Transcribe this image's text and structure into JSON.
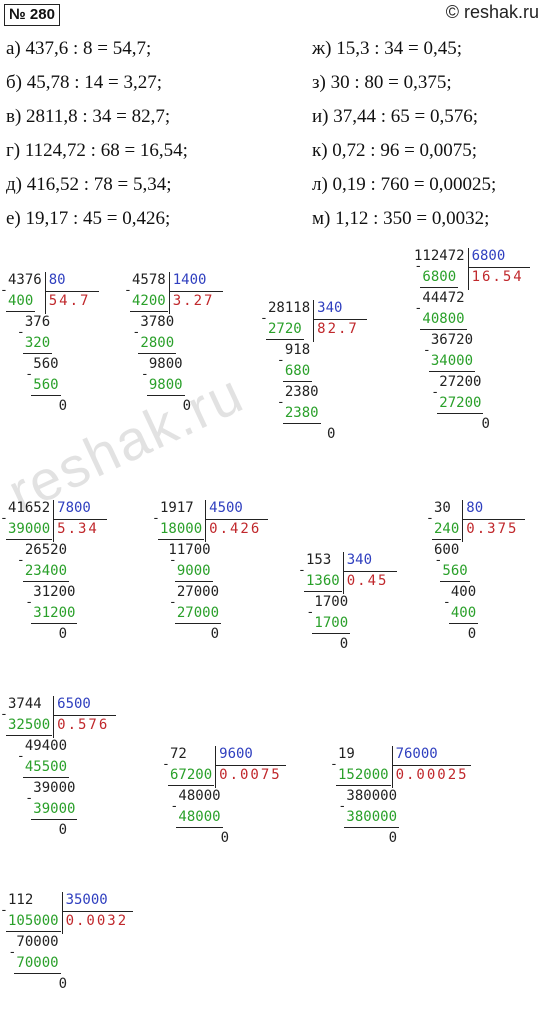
{
  "header": {
    "badge": "№ 280",
    "site": "© reshak.ru"
  },
  "equations": {
    "a": "а) 437,6 : 8 = 54,7;",
    "b": "б) 45,78 : 14 = 3,27;",
    "v": "в) 2811,8 : 34 = 82,7;",
    "g": "г) 1124,72 : 68 = 16,54;",
    "d": "д) 416,52 : 78 = 5,34;",
    "e": "е) 19,17 : 45 = 0,426;",
    "zh": "ж) 15,3 : 34 = 0,45;",
    "z": "з) 30 : 80 = 0,375;",
    "i": "и) 37,44 : 65 = 0,576;",
    "k": "к) 0,72 : 96 = 0,0075;",
    "l": "л) 0,19 : 760 = 0,00025;",
    "m": "м) 1,12 : 350 = 0,0032;"
  },
  "divisions": {
    "d1": {
      "dividend": "4376",
      "divisor": "80",
      "quotient": "54.7",
      "rows": [
        "400",
        "376",
        "320",
        "560",
        "560",
        "0"
      ]
    },
    "d2": {
      "dividend": "4578",
      "divisor": "1400",
      "quotient": "3.27",
      "rows": [
        "4200",
        "3780",
        "2800",
        "9800",
        "9800",
        "0"
      ]
    },
    "d3": {
      "dividend": "28118",
      "divisor": "340",
      "quotient": "82.7",
      "rows": [
        "2720",
        "918",
        "680",
        "2380",
        "2380",
        "0"
      ]
    },
    "d4": {
      "dividend": "112472",
      "divisor": "6800",
      "quotient": "16.54",
      "rows": [
        "6800",
        "44472",
        "40800",
        "36720",
        "34000",
        "27200",
        "27200",
        "0"
      ]
    },
    "d5": {
      "dividend": "41652",
      "divisor": "7800",
      "quotient": "5.34",
      "rows": [
        "39000",
        "26520",
        "23400",
        "31200",
        "31200",
        "0"
      ]
    },
    "d6": {
      "dividend": "1917",
      "divisor": "4500",
      "quotient": "0.426",
      "rows": [
        "18000",
        "11700",
        "9000",
        "27000",
        "27000",
        "0"
      ]
    },
    "d7": {
      "dividend": "153",
      "divisor": "340",
      "quotient": "0.45",
      "rows": [
        "1360",
        "1700",
        "1700",
        "0"
      ]
    },
    "d8": {
      "dividend": "30",
      "divisor": "80",
      "quotient": "0.375",
      "rows": [
        "240",
        "600",
        "560",
        "400",
        "400",
        "0"
      ]
    },
    "d9": {
      "dividend": "3744",
      "divisor": "6500",
      "quotient": "0.576",
      "rows": [
        "32500",
        "49400",
        "45500",
        "39000",
        "39000",
        "0"
      ]
    },
    "d10": {
      "dividend": "72",
      "divisor": "9600",
      "quotient": "0.0075",
      "rows": [
        "67200",
        "48000",
        "48000",
        "0"
      ]
    },
    "d11": {
      "dividend": "19",
      "divisor": "76000",
      "quotient": "0.00025",
      "rows": [
        "152000",
        "380000",
        "380000",
        "0"
      ]
    },
    "d12": {
      "dividend": "112",
      "divisor": "35000",
      "quotient": "0.0032",
      "rows": [
        "105000",
        "70000",
        "70000",
        "0"
      ]
    }
  },
  "watermark": "reshak.ru",
  "colors": {
    "divisor": "#2f3fbf",
    "subtrahend": "#2aa02a",
    "quotient": "#c0282c",
    "text": "#111111"
  }
}
